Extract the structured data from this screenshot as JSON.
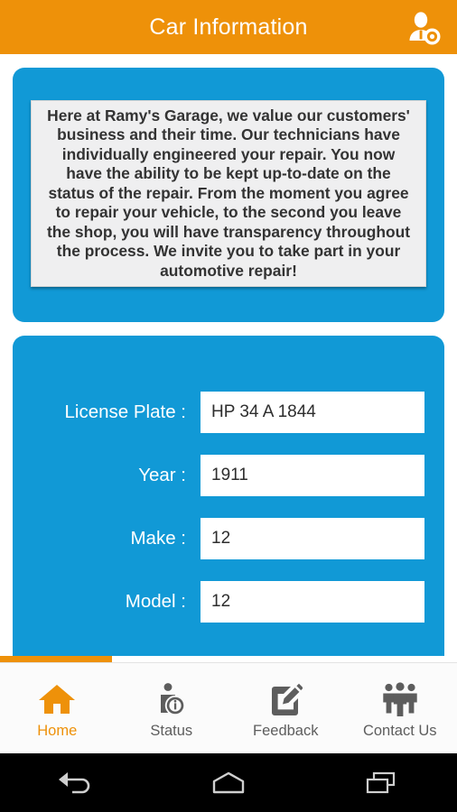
{
  "appbar": {
    "title": "Car Information",
    "action_icon": "user-profile-settings-icon"
  },
  "notice": {
    "text": "Here at Ramy's Garage, we value our customers' business and their time. Our technicians have individually engineered your repair. You now have the ability to be kept up-to-date on the status of the repair. From the moment you agree to repair your vehicle, to the second you leave the shop, you will have transparency throughout the process. We invite you to take part in your automotive repair!"
  },
  "form": {
    "fields": [
      {
        "label": "License Plate :",
        "value": "HP 34 A 1844",
        "placeholder": ""
      },
      {
        "label": "Year :",
        "value": "1911",
        "placeholder": ""
      },
      {
        "label": "Make :",
        "value": "12",
        "placeholder": ""
      },
      {
        "label": "Model :",
        "value": "12",
        "placeholder": ""
      }
    ]
  },
  "tabbar": {
    "tabs": [
      {
        "label": "Home",
        "icon": "home-icon",
        "active": true
      },
      {
        "label": "Status",
        "icon": "person-info-icon",
        "active": false
      },
      {
        "label": "Feedback",
        "icon": "edit-pencil-icon",
        "active": false
      },
      {
        "label": "Contact Us",
        "icon": "people-group-icon",
        "active": false
      }
    ]
  },
  "sysnav": {
    "buttons": [
      {
        "name": "back-icon"
      },
      {
        "name": "home-icon"
      },
      {
        "name": "recents-icon"
      }
    ]
  },
  "colors": {
    "accent_orange": "#ee9109",
    "card_blue": "#1199d6",
    "notice_bg": "#efeff0",
    "tab_inactive": "#5d5d5d"
  }
}
